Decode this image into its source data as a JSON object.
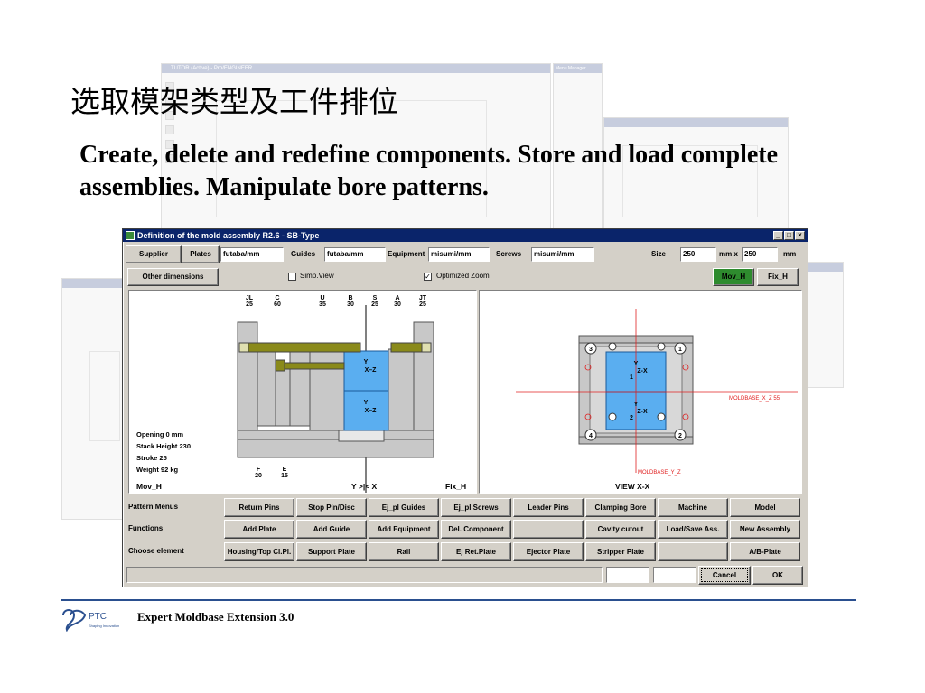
{
  "slide": {
    "title": "选取模架类型及工件排位",
    "subtitle": "Create, delete and redefine components. Store and load complete assemblies. Manipulate bore patterns.",
    "footer": "Expert Moldbase Extension 3.0",
    "logo_text": "PTC",
    "logo_tagline": "Shaping Innovation"
  },
  "background": {
    "win1_title": "TUTOR (Active) - Pro/ENGINEER",
    "win2_title": "Menu Manager"
  },
  "dialog": {
    "title": "Definition of the mold assembly R2.6 - SB-Type",
    "top_row": {
      "supplier_label": "Supplier",
      "plates_label": "Plates",
      "plates_value": "futaba/mm",
      "guides_label": "Guides",
      "guides_value": "futaba/mm",
      "equipment_label": "Equipment",
      "equipment_value": "misumi/mm",
      "screws_label": "Screws",
      "screws_value": "misumi/mm",
      "size_label": "Size",
      "size_x": "250",
      "size_sep": "mm x",
      "size_y": "250",
      "size_unit": "mm"
    },
    "second_row": {
      "other_dimensions": "Other dimensions",
      "simp_view": "Simp.View",
      "optimized_zoom": "Optimized Zoom",
      "mov_h": "Mov_H",
      "fix_h": "Fix_H"
    },
    "left_panel": {
      "dims": [
        {
          "name": "JL",
          "value": "25"
        },
        {
          "name": "C",
          "value": "60"
        },
        {
          "name": "U",
          "value": "35"
        },
        {
          "name": "B",
          "value": "30"
        },
        {
          "name": "S",
          "value": "25"
        },
        {
          "name": "A",
          "value": "30"
        },
        {
          "name": "JT",
          "value": "25"
        }
      ],
      "bottom_dims": [
        {
          "name": "F",
          "value": "20"
        },
        {
          "name": "E",
          "value": "15"
        }
      ],
      "info": [
        "Opening 0 mm",
        "Stack Height 230",
        "Stroke 25",
        "Weight 92 kg"
      ],
      "axis_yz": "Y-Z",
      "axis_label": "Y",
      "axis_zlabel": "X–Z",
      "bottom_left": "Mov_H",
      "bottom_center": "Y >|< X",
      "bottom_right": "Fix_H"
    },
    "right_panel": {
      "moldbase_xz": "MOLDBASE_X_Z 55",
      "moldbase_yz": "MOLDBASE_Y_Z",
      "view_label": "VIEW X-X",
      "cavity_1": "1",
      "cavity_2": "2",
      "axis_y": "Y",
      "axis_zx": "Z-X",
      "screws": [
        "3",
        "1",
        "4",
        "2"
      ]
    },
    "rows": [
      {
        "label": "Pattern Menus",
        "buttons": [
          "Return Pins",
          "Stop Pin/Disc",
          "Ej_pl Guides",
          "Ej_pl Screws",
          "Leader Pins",
          "Clamping Bore",
          "Machine",
          "Model"
        ]
      },
      {
        "label": "Functions",
        "buttons": [
          "Add Plate",
          "Add Guide",
          "Add Equipment",
          "Del. Component",
          "",
          "Cavity cutout",
          "Load/Save Ass.",
          "New Assembly"
        ]
      },
      {
        "label": "Choose element",
        "buttons": [
          "Housing/Top Cl.Pl.",
          "Support Plate",
          "Rail",
          "Ej Ret.Plate",
          "Ejector Plate",
          "Stripper Plate",
          "",
          "A/B-Plate"
        ]
      }
    ],
    "cancel": "Cancel",
    "ok": "OK"
  },
  "colors": {
    "titlebar": "#0a246a",
    "cavity": "#5aaef0",
    "plate": "#c8c8c8",
    "rail": "#8a8a1a",
    "green_button": "#2e8b2e",
    "axis_red": "#e02020",
    "footer_line": "#2a4f8f"
  }
}
